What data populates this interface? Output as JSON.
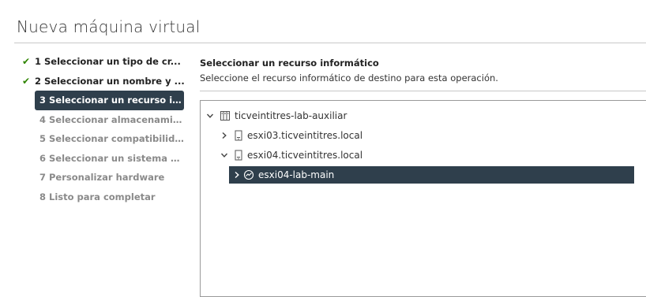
{
  "wizard": {
    "title": "Nueva máquina virtual",
    "steps": [
      {
        "label": "1 Seleccionar un tipo de cr...",
        "state": "done"
      },
      {
        "label": "2 Seleccionar un nombre y ...",
        "state": "done"
      },
      {
        "label": "3 Seleccionar un recurso in...",
        "state": "active"
      },
      {
        "label": "4 Seleccionar almacenamie...",
        "state": "pending"
      },
      {
        "label": "5 Seleccionar compatibilid...",
        "state": "pending"
      },
      {
        "label": "6 Seleccionar un sistema o...",
        "state": "pending"
      },
      {
        "label": "7 Personalizar hardware",
        "state": "pending"
      },
      {
        "label": "8 Listo para completar",
        "state": "pending"
      }
    ]
  },
  "content": {
    "heading": "Seleccionar un recurso informático",
    "description": "Seleccione el recurso informático de destino para esta operación."
  },
  "tree": {
    "datacenter": {
      "label": "ticveintitres-lab-auxiliar",
      "icon": "datacenter-icon",
      "expanded": true
    },
    "host1": {
      "label": "esxi03.ticveintitres.local",
      "icon": "host-icon",
      "expanded": false
    },
    "host2": {
      "label": "esxi04.ticveintitres.local",
      "icon": "host-icon",
      "expanded": true
    },
    "pool": {
      "label": "esxi04-lab-main",
      "icon": "resource-pool-icon",
      "expanded": false,
      "selected": true
    }
  },
  "colors": {
    "active_bg": "#2f3f4c",
    "check": "#2f8400",
    "pending_text": "#8a8a8a"
  }
}
